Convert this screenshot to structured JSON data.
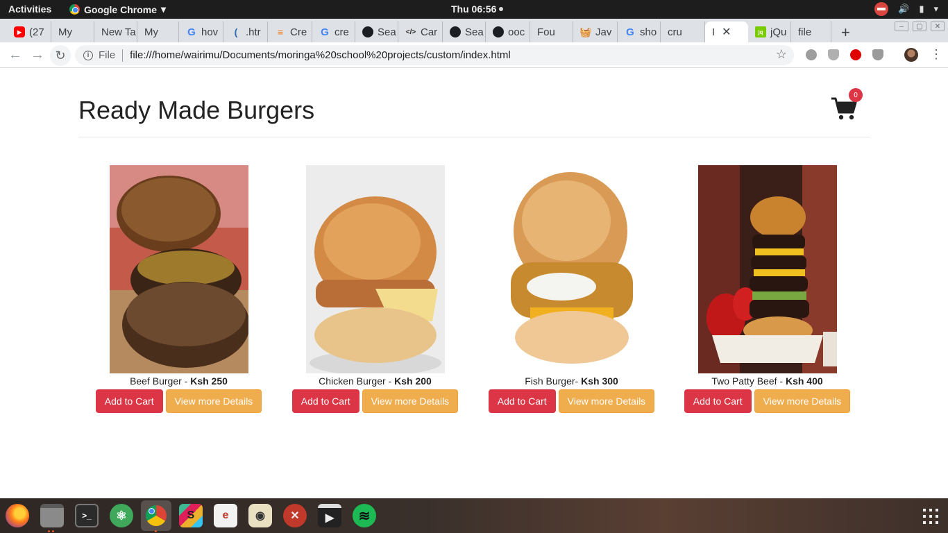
{
  "system_bar": {
    "activities": "Activities",
    "app_name": "Google Chrome",
    "app_menu_arrow": "▾",
    "clock": "Thu 06:56"
  },
  "browser": {
    "tabs": [
      {
        "icon": "youtube-icon",
        "label": "(27"
      },
      {
        "icon": "page-icon",
        "label": "My"
      },
      {
        "icon": "none",
        "label": "New Ta"
      },
      {
        "icon": "page-icon",
        "label": "My"
      },
      {
        "icon": "google-icon",
        "label": "hov"
      },
      {
        "icon": "wave-icon",
        "label": ".htr"
      },
      {
        "icon": "stackoverflow-icon",
        "label": "Cre"
      },
      {
        "icon": "google-icon",
        "label": "cre"
      },
      {
        "icon": "github-icon",
        "label": "Sea"
      },
      {
        "icon": "code-icon",
        "label": "Car"
      },
      {
        "icon": "github-icon",
        "label": "Sea"
      },
      {
        "icon": "github-icon",
        "label": "ooc"
      },
      {
        "icon": "page-icon",
        "label": "Fou"
      },
      {
        "icon": "basket-icon",
        "label": "Jav"
      },
      {
        "icon": "google-icon",
        "label": "sho"
      },
      {
        "icon": "page-icon",
        "label": "cru"
      },
      {
        "icon": "page-icon",
        "label": "I"
      },
      {
        "icon": "jquery-icon",
        "label": "jQu"
      },
      {
        "icon": "page-icon",
        "label": "file"
      }
    ],
    "active_tab_index": 16,
    "new_tab": "+",
    "address": {
      "scheme_label": "File",
      "url": "file:///home/wairimu/Documents/moringa%20school%20projects/custom/index.html"
    }
  },
  "page": {
    "title": "Ready Made Burgers",
    "cart_count": "0",
    "products": [
      {
        "name": "Beef Burger - ",
        "price": "Ksh 250",
        "add_label": "Add to Cart",
        "details_label": "View more Details",
        "image": "beef-burger-image"
      },
      {
        "name": "Chicken Burger - ",
        "price": "Ksh 200",
        "add_label": "Add to Cart",
        "details_label": "View more Details",
        "image": "chicken-burger-image"
      },
      {
        "name": "Fish Burger- ",
        "price": "Ksh 300",
        "add_label": "Add to Cart",
        "details_label": "View more Details",
        "image": "fish-burger-image"
      },
      {
        "name": "Two Patty Beef - ",
        "price": "Ksh 400",
        "add_label": "Add to Cart",
        "details_label": "View more Details",
        "image": "two-patty-burger-image"
      }
    ]
  },
  "dock": {
    "apps": [
      "firefox-icon",
      "files-icon",
      "terminal-icon",
      "atom-icon",
      "chrome-icon",
      "slack-icon",
      "editor-icon",
      "audio-icon",
      "settings-icon",
      "video-editor-icon",
      "spotify-icon"
    ],
    "show_apps": "show-applications-icon"
  },
  "colors": {
    "danger": "#dc3545",
    "warning": "#f0ad4e",
    "topbar": "#1d1d1d",
    "tabstrip": "#dee1e6"
  }
}
